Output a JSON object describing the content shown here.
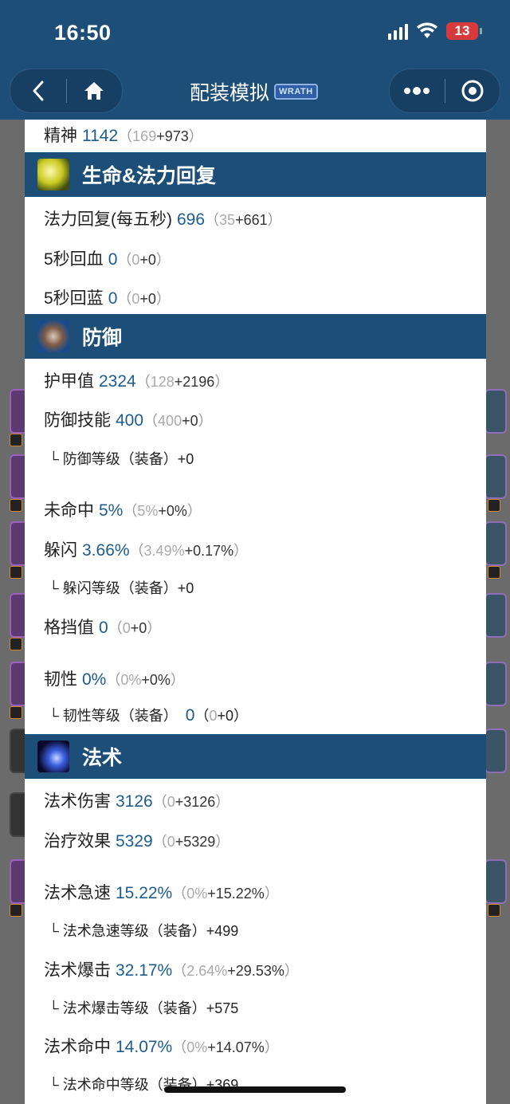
{
  "status": {
    "time": "16:50",
    "battery": "13"
  },
  "nav": {
    "title": "配装模拟",
    "badge": "WRATH"
  },
  "sections": {
    "top_row": {
      "label": "精神",
      "value": "1142",
      "base": "169",
      "plus": "+973"
    },
    "regen": {
      "title": "生命&法力回复",
      "rows": [
        {
          "label": "法力回复(每五秒)",
          "value": "696",
          "base": "35",
          "plus": "+661"
        },
        {
          "label": "5秒回血",
          "value": "0",
          "base": "0",
          "plus": "+0"
        },
        {
          "label": "5秒回蓝",
          "value": "0",
          "base": "0",
          "plus": "+0"
        }
      ]
    },
    "defense": {
      "title": "防御",
      "rows": [
        {
          "label": "护甲值",
          "value": "2324",
          "base": "128",
          "plus": "+2196"
        },
        {
          "label": "防御技能",
          "value": "400",
          "base": "400",
          "plus": "+0"
        },
        {
          "label": "未命中",
          "value": "5%",
          "base": "5%",
          "plus": "+0%"
        },
        {
          "label": "躲闪",
          "value": "3.66%",
          "base": "3.49%",
          "plus": "+0.17%"
        },
        {
          "label": "格挡值",
          "value": "0",
          "base": "0",
          "plus": "+0"
        },
        {
          "label": "韧性",
          "value": "0%",
          "base": "0%",
          "plus": "+0%"
        }
      ],
      "subs": {
        "defense_rating": "└ 防御等级（装备）+0",
        "dodge_rating": "└ 躲闪等级（装备）+0",
        "resil_label": "└ 韧性等级（装备）",
        "resil_value": "0",
        "resil_base": "0",
        "resil_plus": "+0"
      }
    },
    "spell": {
      "title": "法术",
      "rows": [
        {
          "label": "法术伤害",
          "value": "3126",
          "base": "0",
          "plus": "+3126"
        },
        {
          "label": "治疗效果",
          "value": "5329",
          "base": "0",
          "plus": "+5329"
        },
        {
          "label": "法术急速",
          "value": "15.22%",
          "base": "0%",
          "plus": "+15.22%"
        },
        {
          "label": "法术爆击",
          "value": "32.17%",
          "base": "2.64%",
          "plus": "+29.53%"
        },
        {
          "label": "法术命中",
          "value": "14.07%",
          "base": "0%",
          "plus": "+14.07%"
        }
      ],
      "subs": {
        "haste_rating": "└ 法术急速等级（装备）+499",
        "crit_rating": "└ 法术爆击等级（装备）+575",
        "hit_rating": "└ 法术命中等级（装备）+369"
      }
    }
  },
  "paren_open": "（",
  "paren_close": "）"
}
